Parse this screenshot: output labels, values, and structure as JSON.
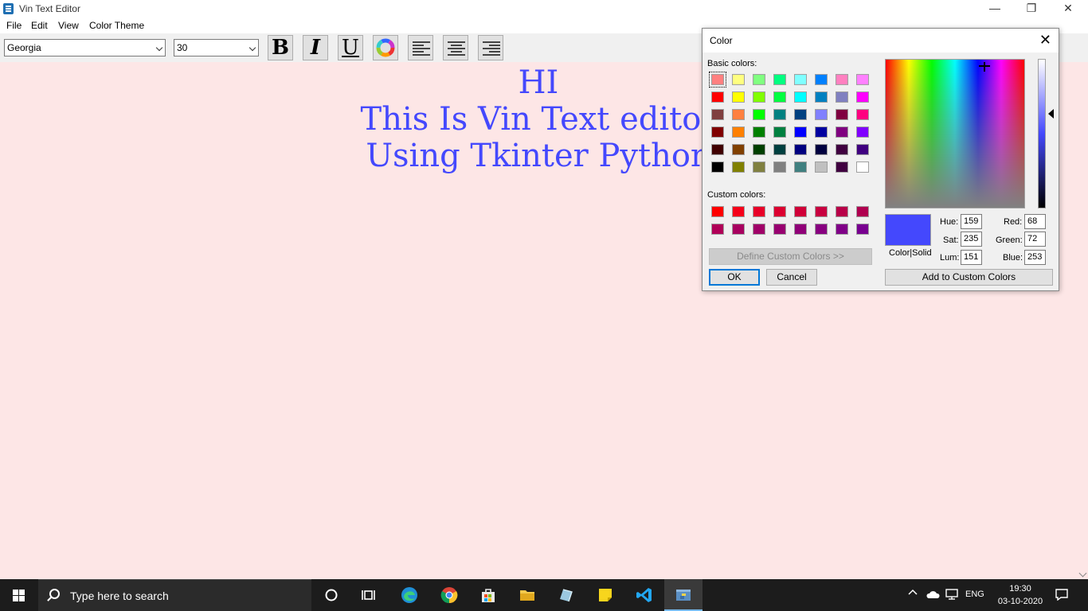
{
  "window": {
    "title": "Vin Text Editor",
    "minimize": "—",
    "restore": "❐",
    "close": "✕"
  },
  "menu": [
    "File",
    "Edit",
    "View",
    "Color Theme"
  ],
  "toolbar": {
    "font_family": "Georgia",
    "font_size": "30",
    "bold_label": "B",
    "italic_label": "I",
    "underline_label": "U",
    "icons": [
      "bold-icon",
      "italic-icon",
      "underline-icon",
      "color-wheel-icon",
      "align-left-icon",
      "align-center-icon",
      "align-right-icon"
    ]
  },
  "editor": {
    "lines": [
      "HI",
      "This Is Vin Text editor",
      "Using Tkinter Python"
    ],
    "text_color": "#4448fd",
    "background": "#fde6e6"
  },
  "color_dialog": {
    "title": "Color",
    "basic_colors_label": "Basic colors:",
    "custom_colors_label": "Custom colors:",
    "basic_colors": [
      [
        "#ff8080",
        "#ffff80",
        "#80ff80",
        "#00ff80",
        "#80ffff",
        "#0080ff",
        "#ff80c0",
        "#ff80ff"
      ],
      [
        "#ff0000",
        "#ffff00",
        "#80ff00",
        "#00ff40",
        "#00ffff",
        "#0080c0",
        "#8080c0",
        "#ff00ff"
      ],
      [
        "#804040",
        "#ff8040",
        "#00ff00",
        "#008080",
        "#004080",
        "#8080ff",
        "#800040",
        "#ff0080"
      ],
      [
        "#800000",
        "#ff8000",
        "#008000",
        "#008040",
        "#0000ff",
        "#0000a0",
        "#800080",
        "#8000ff"
      ],
      [
        "#400000",
        "#804000",
        "#004000",
        "#004040",
        "#000080",
        "#000040",
        "#400040",
        "#400080"
      ],
      [
        "#000000",
        "#808000",
        "#808040",
        "#808080",
        "#408080",
        "#c0c0c0",
        "#400040",
        "#ffffff"
      ]
    ],
    "custom_colors": [
      [
        "#ff0000",
        "#f5001a",
        "#e80028",
        "#dc0030",
        "#d00038",
        "#c80040",
        "#b80048",
        "#b00050"
      ],
      [
        "#b00058",
        "#a80060",
        "#a00068",
        "#980070",
        "#900078",
        "#880080",
        "#800088",
        "#780090"
      ]
    ],
    "define_custom_button": "Define Custom Colors >>",
    "ok_button": "OK",
    "cancel_button": "Cancel",
    "add_custom_button": "Add to Custom Colors",
    "preview_label": "Color|Solid",
    "hue_label": "Hue:",
    "hue": "159",
    "sat_label": "Sat:",
    "sat": "235",
    "lum_label": "Lum:",
    "lum": "151",
    "red_label": "Red:",
    "red": "68",
    "green_label": "Green:",
    "green": "72",
    "blue_label": "Blue:",
    "blue": "253",
    "selected_color": "#4448fd"
  },
  "taskbar": {
    "search_placeholder": "Type here to search",
    "language": "ENG",
    "time": "19:30",
    "date": "03-10-2020",
    "pinned": [
      "cortana-icon",
      "task-view-icon",
      "edge-icon",
      "chrome-icon",
      "store-icon",
      "file-explorer-icon",
      "app-icon",
      "sticky-notes-icon",
      "vscode-icon",
      "python-icon"
    ]
  }
}
